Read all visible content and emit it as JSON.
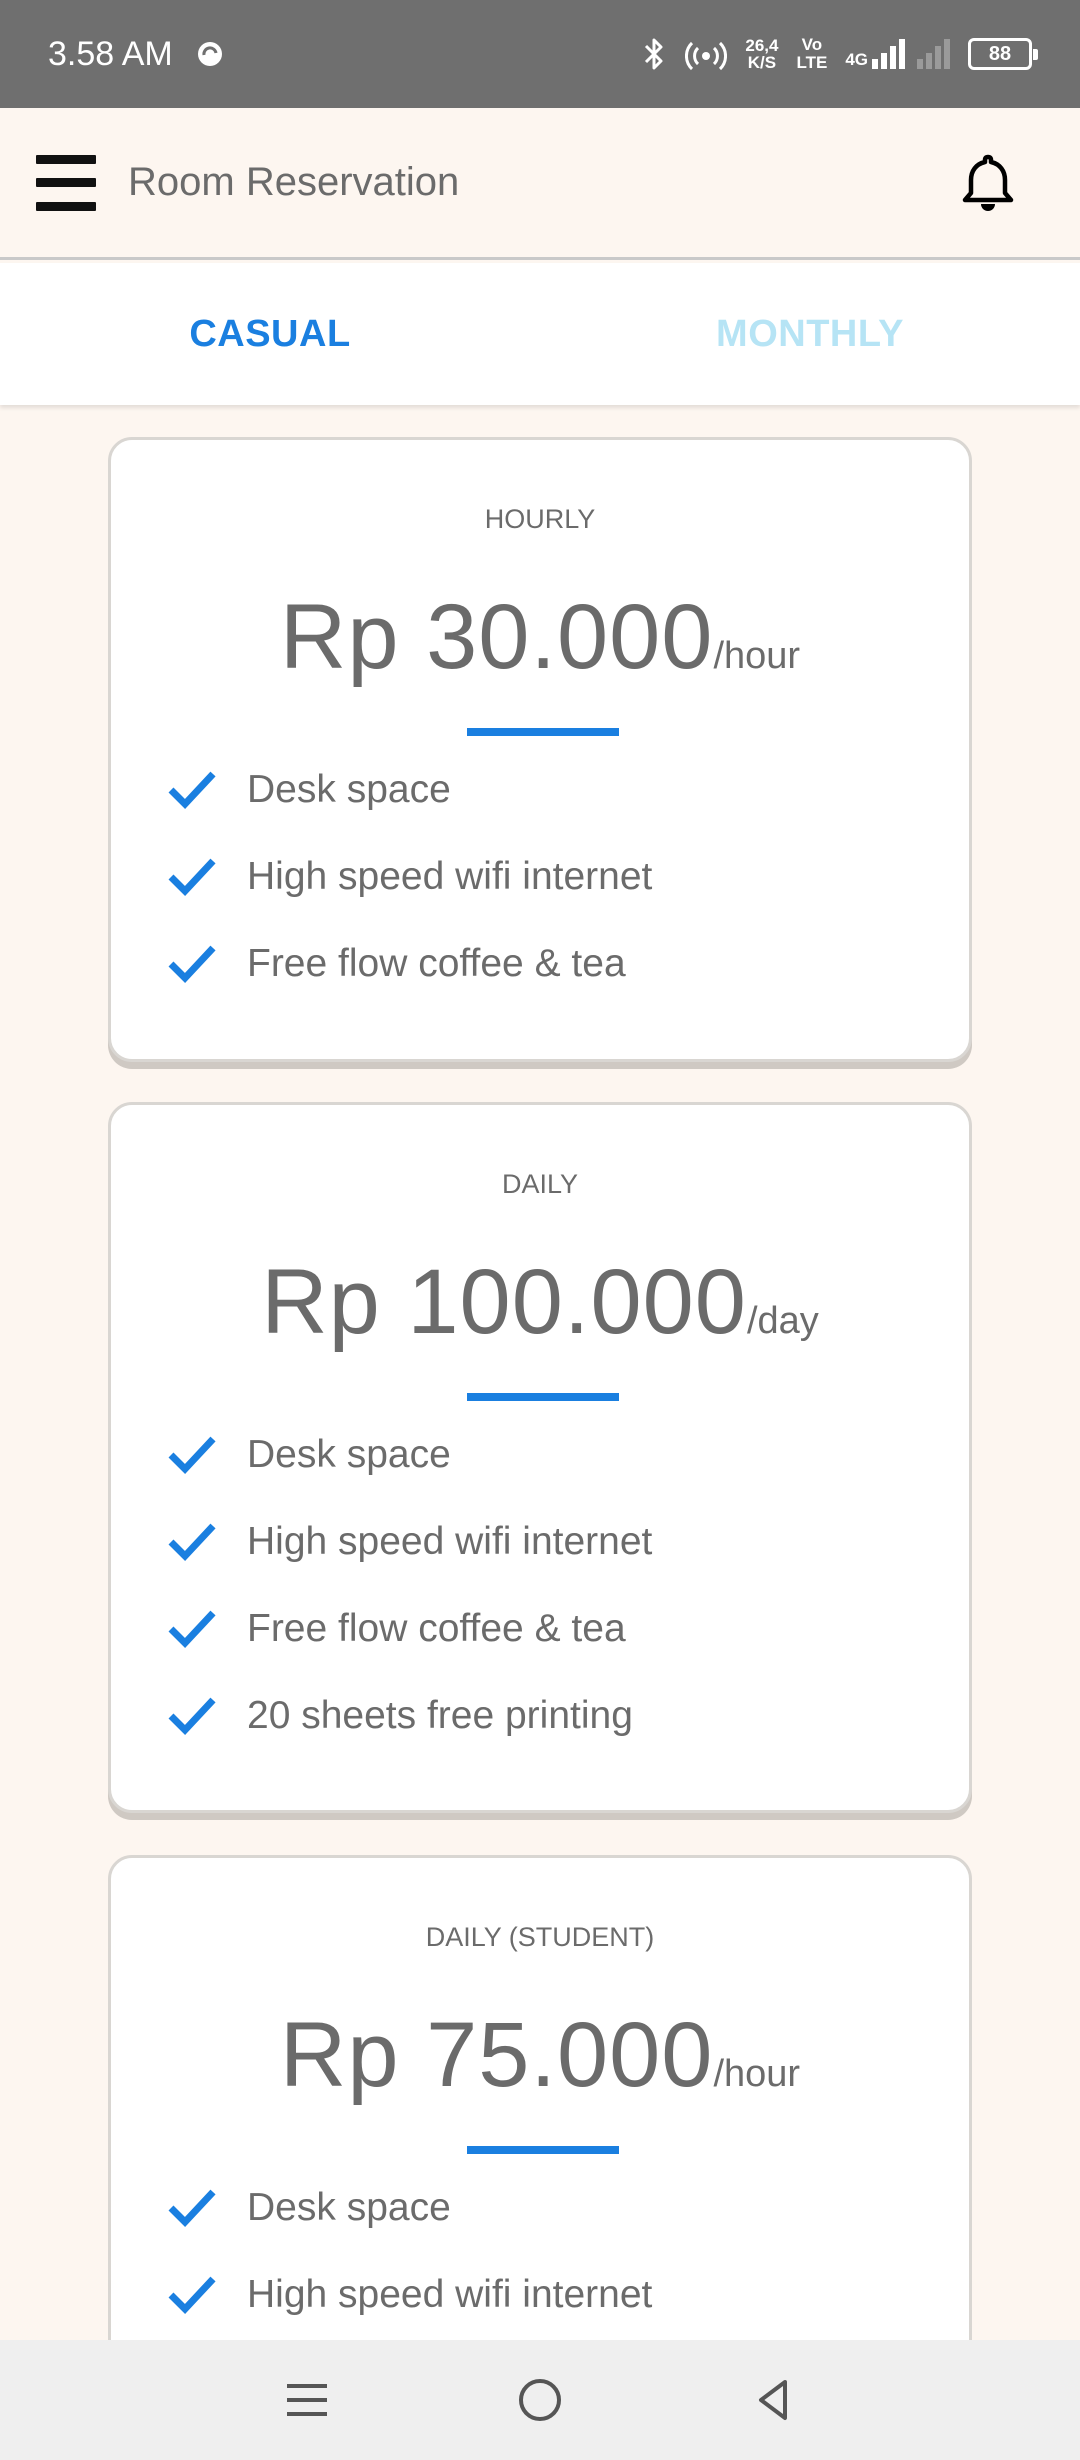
{
  "status_bar": {
    "time": "3.58 AM",
    "net_speed_value": "26,4",
    "net_speed_unit": "K/S",
    "volte_top": "Vo",
    "volte_bottom": "LTE",
    "network_type": "4G",
    "battery_level": "88",
    "icons": [
      "sync-icon",
      "bluetooth-icon",
      "hotspot-icon",
      "signal-icon",
      "battery-icon"
    ]
  },
  "app_bar": {
    "title": "Room Reservation",
    "menu_icon": "hamburger-menu-icon",
    "notification_icon": "bell-icon"
  },
  "tabs": [
    {
      "label": "CASUAL",
      "active": true
    },
    {
      "label": "MONTHLY",
      "active": false
    }
  ],
  "plans": [
    {
      "label": "HOURLY",
      "price": "Rp 30.000",
      "unit": "/hour",
      "features": [
        "Desk space",
        "High speed wifi internet",
        "Free flow coffee & tea"
      ]
    },
    {
      "label": "DAILY",
      "price": "Rp 100.000",
      "unit": "/day",
      "features": [
        "Desk space",
        "High speed wifi internet",
        "Free flow coffee & tea",
        "20 sheets free printing"
      ]
    },
    {
      "label": "DAILY (STUDENT)",
      "price": "Rp 75.000",
      "unit": "/hour",
      "features": [
        "Desk space",
        "High speed wifi internet",
        ""
      ]
    }
  ],
  "colors": {
    "accent": "#1a7fe0",
    "inactive_tab": "#b6e4f5",
    "background": "#fdf6f0",
    "text": "#6b6b6b",
    "status_bar": "#6f6f6f"
  },
  "nav_bar": {
    "icons": [
      "recent-apps-icon",
      "home-icon",
      "back-icon"
    ]
  }
}
